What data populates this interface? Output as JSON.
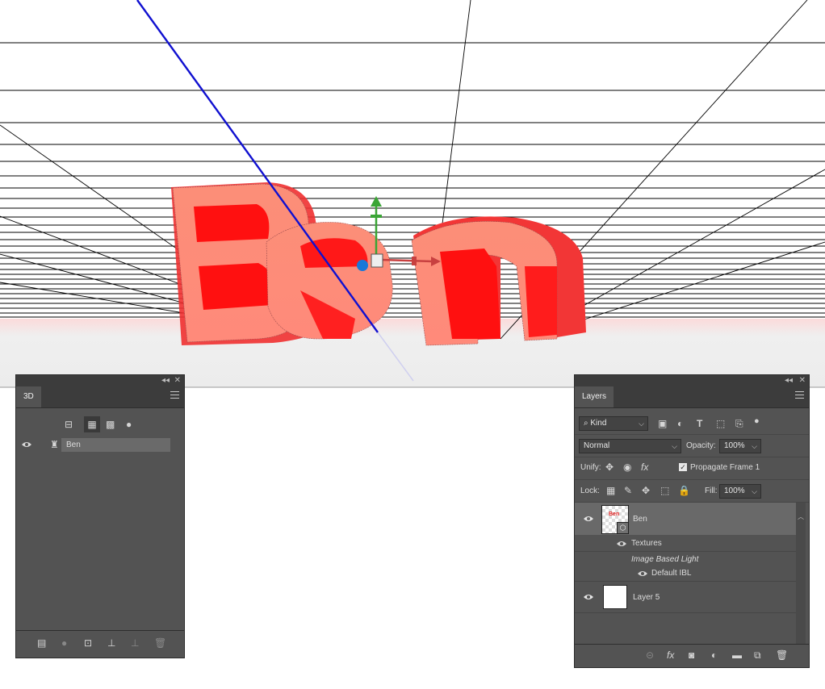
{
  "canvas": {
    "text_3d": "Ben",
    "grid_color": "#000000",
    "ground_color": "#f0f0f0",
    "axis_colors": {
      "x": "#c84040",
      "y": "#3aa535",
      "z": "#1a78d8",
      "ray": "#1010d0"
    }
  },
  "panel_3d": {
    "tab_label": "3D",
    "filter_icons": [
      "scene-icon",
      "mesh-icon",
      "material-icon",
      "light-icon"
    ],
    "items": [
      {
        "label": "Ben",
        "visible": true
      }
    ],
    "footer_icons": [
      "new-mesh-icon",
      "new-light-icon",
      "render-icon",
      "ground-icon",
      "delete-light-icon",
      "trash-icon"
    ]
  },
  "panel_layers": {
    "tab_label": "Layers",
    "kind": "Kind",
    "blend_mode": "Normal",
    "opacity_label": "Opacity:",
    "opacity": "100%",
    "unify_label": "Unify:",
    "propagate_label": "Propagate Frame 1",
    "propagate_checked": true,
    "lock_label": "Lock:",
    "fill_label": "Fill:",
    "fill": "100%",
    "layers": [
      {
        "name": "Ben",
        "type": "3d",
        "visible": true,
        "selected": true
      },
      {
        "name": "Layer 5",
        "type": "pixel",
        "visible": true,
        "selected": false
      }
    ],
    "sublayers": {
      "textures": "Textures",
      "ibl_group": "Image Based Light",
      "default_ibl": "Default IBL"
    },
    "footer_icons": [
      "link-icon",
      "fx-icon",
      "mask-icon",
      "adjustment-icon",
      "folder-icon",
      "new-layer-icon",
      "trash-icon"
    ]
  }
}
